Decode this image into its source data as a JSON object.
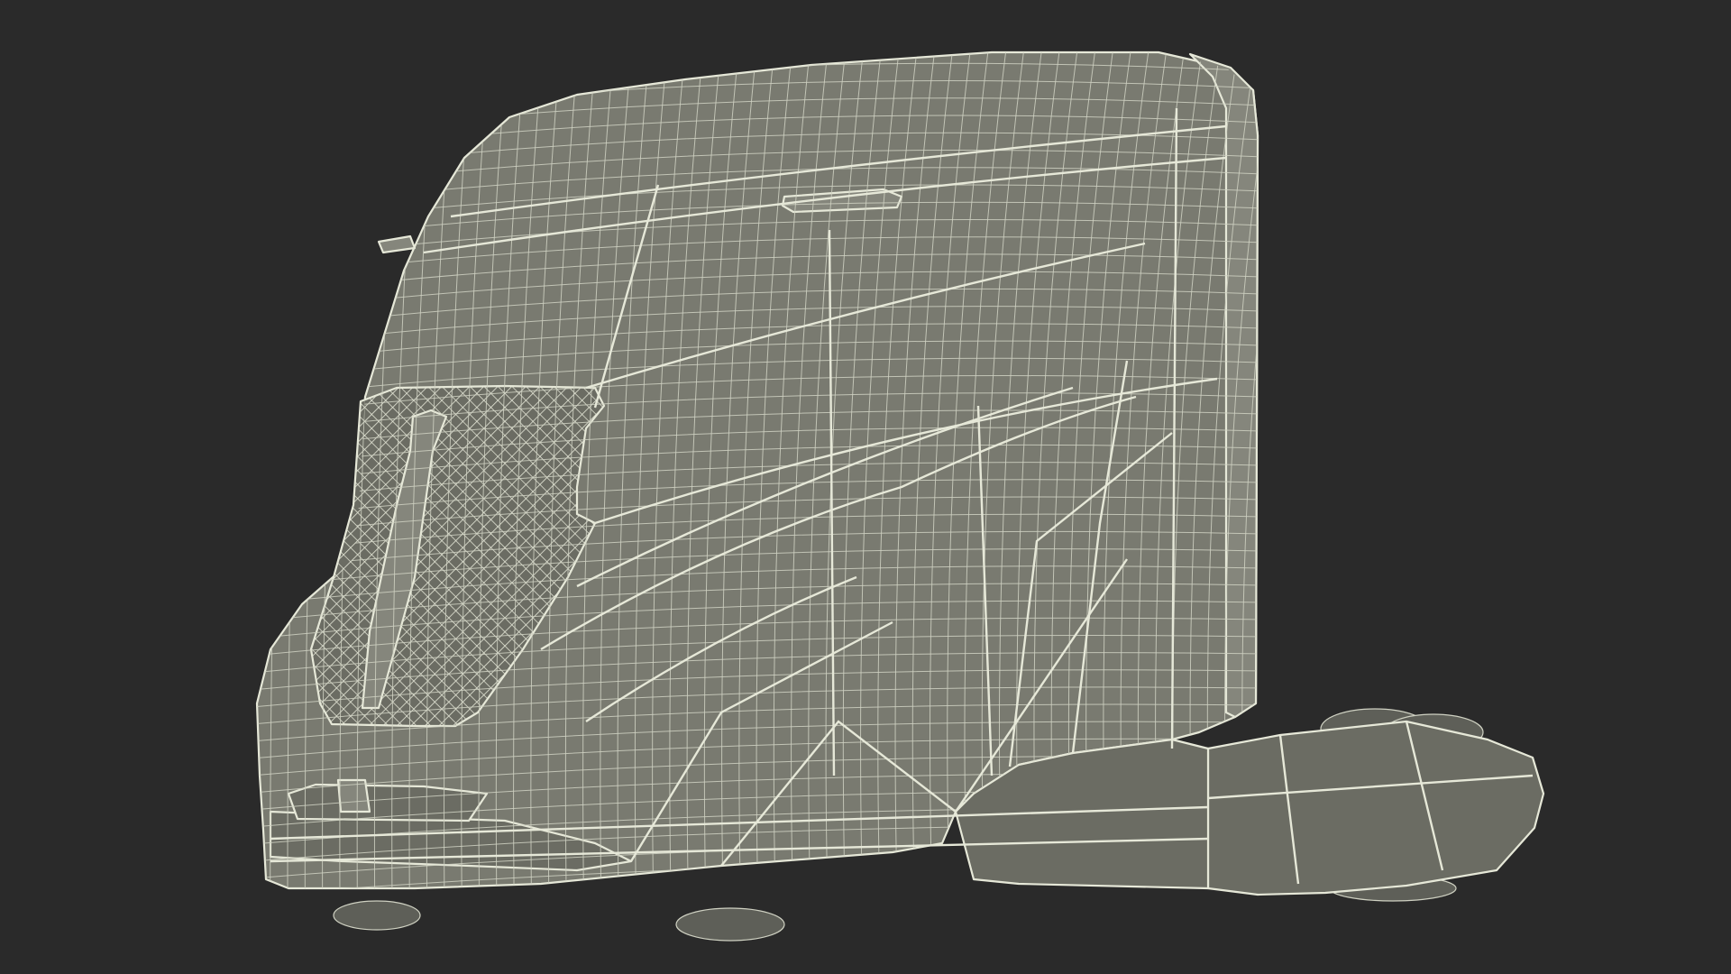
{
  "scene": {
    "subject": "truck-cab-wireframe",
    "colors": {
      "background": "#2a2a2a",
      "surface": "#797a70",
      "surface_dark": "#6b6c63",
      "surface_light": "#85867c",
      "wire": "#e6e8d8",
      "wire_soft": "#cfd1c2",
      "tire": "#5e5f58"
    }
  }
}
